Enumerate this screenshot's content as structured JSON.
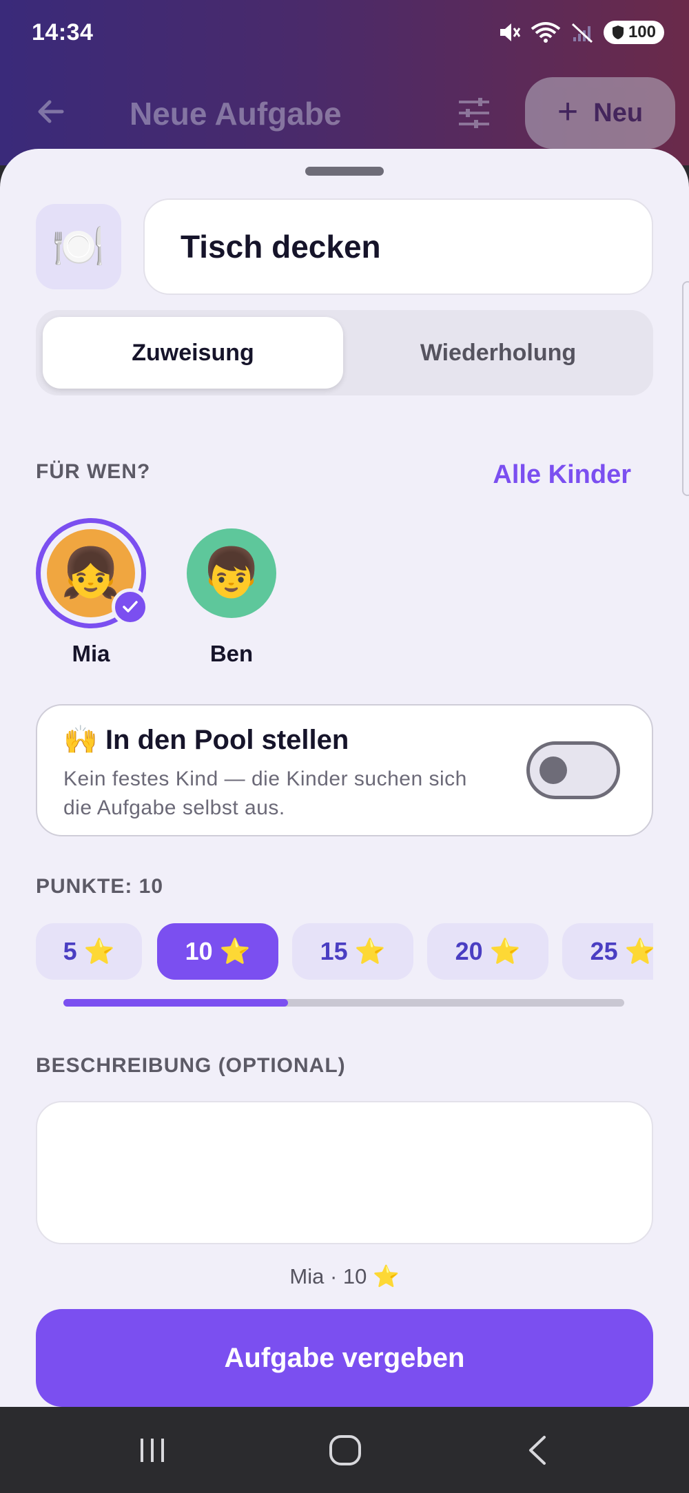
{
  "status_bar": {
    "time": "14:34",
    "battery": "100"
  },
  "app_header": {
    "title": "Neue Aufgabe",
    "new_button_label": "Neu"
  },
  "task": {
    "icon": "🍽️",
    "name": "Tisch decken"
  },
  "tabs": [
    {
      "label": "Zuweisung",
      "active": true
    },
    {
      "label": "Wiederholung",
      "active": false
    }
  ],
  "assignee": {
    "section_label": "FÜR WEN?",
    "all_children_label": "Alle Kinder",
    "children": [
      {
        "name": "Mia",
        "emoji": "👧",
        "selected": true,
        "color": "#f0a640"
      },
      {
        "name": "Ben",
        "emoji": "👦",
        "selected": false,
        "color": "#5ec79b"
      }
    ]
  },
  "pool": {
    "emoji": "🙌",
    "title": "In den Pool stellen",
    "description": "Kein festes Kind — die Kinder suchen sich die Aufgabe selbst aus.",
    "enabled": false
  },
  "points": {
    "section_label": "PUNKTE: 10",
    "options": [
      "5",
      "10",
      "15",
      "20",
      "25"
    ],
    "selected": "10",
    "star": "⭐",
    "scroll_fraction": 0.4
  },
  "description": {
    "section_label": "BESCHREIBUNG (OPTIONAL)",
    "value": ""
  },
  "summary": "Mia · 10 ⭐",
  "submit_label": "Aufgabe vergeben",
  "colors": {
    "accent": "#7b4ff0",
    "sheet_background": "#f1eff9"
  }
}
